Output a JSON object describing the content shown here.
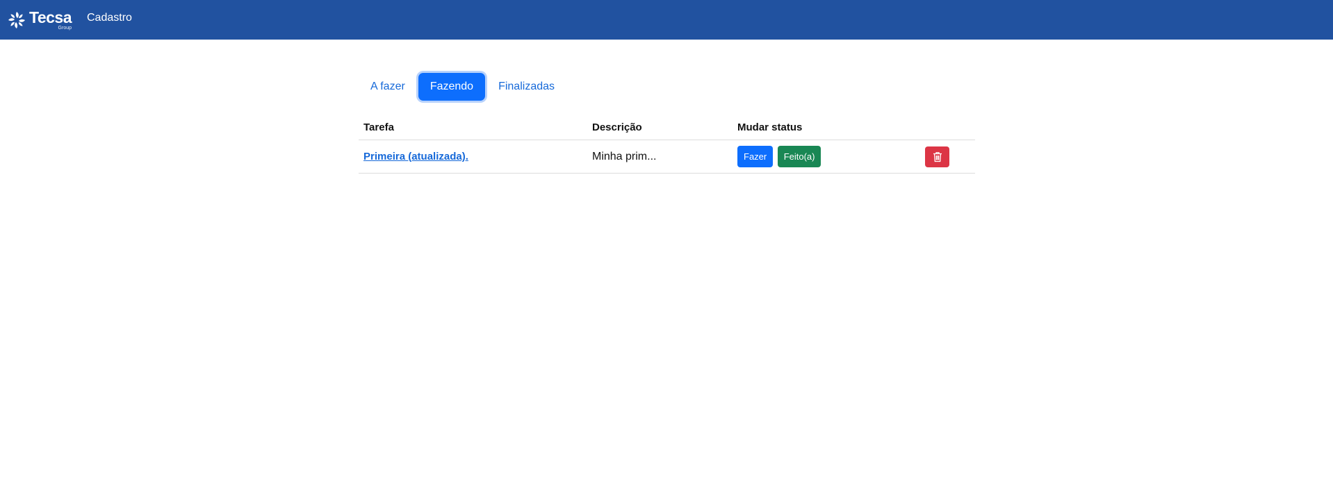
{
  "navbar": {
    "brand_name": "Tecsa",
    "brand_sub": "Group",
    "link": "Cadastro",
    "color": "#2152a0"
  },
  "tabs": [
    {
      "label": "A fazer",
      "active": false
    },
    {
      "label": "Fazendo",
      "active": true
    },
    {
      "label": "Finalizadas",
      "active": false
    }
  ],
  "table": {
    "headers": {
      "task": "Tarefa",
      "description": "Descrição",
      "status": "Mudar status"
    },
    "rows": [
      {
        "task": "Primeira (atualizada).",
        "description": "Minha prim...",
        "btn_fazer": "Fazer",
        "btn_feito": "Feito(a)",
        "delete_icon": "trash-icon"
      }
    ]
  },
  "colors": {
    "primary": "#0d6efd",
    "success": "#198754",
    "danger": "#dc3545"
  }
}
